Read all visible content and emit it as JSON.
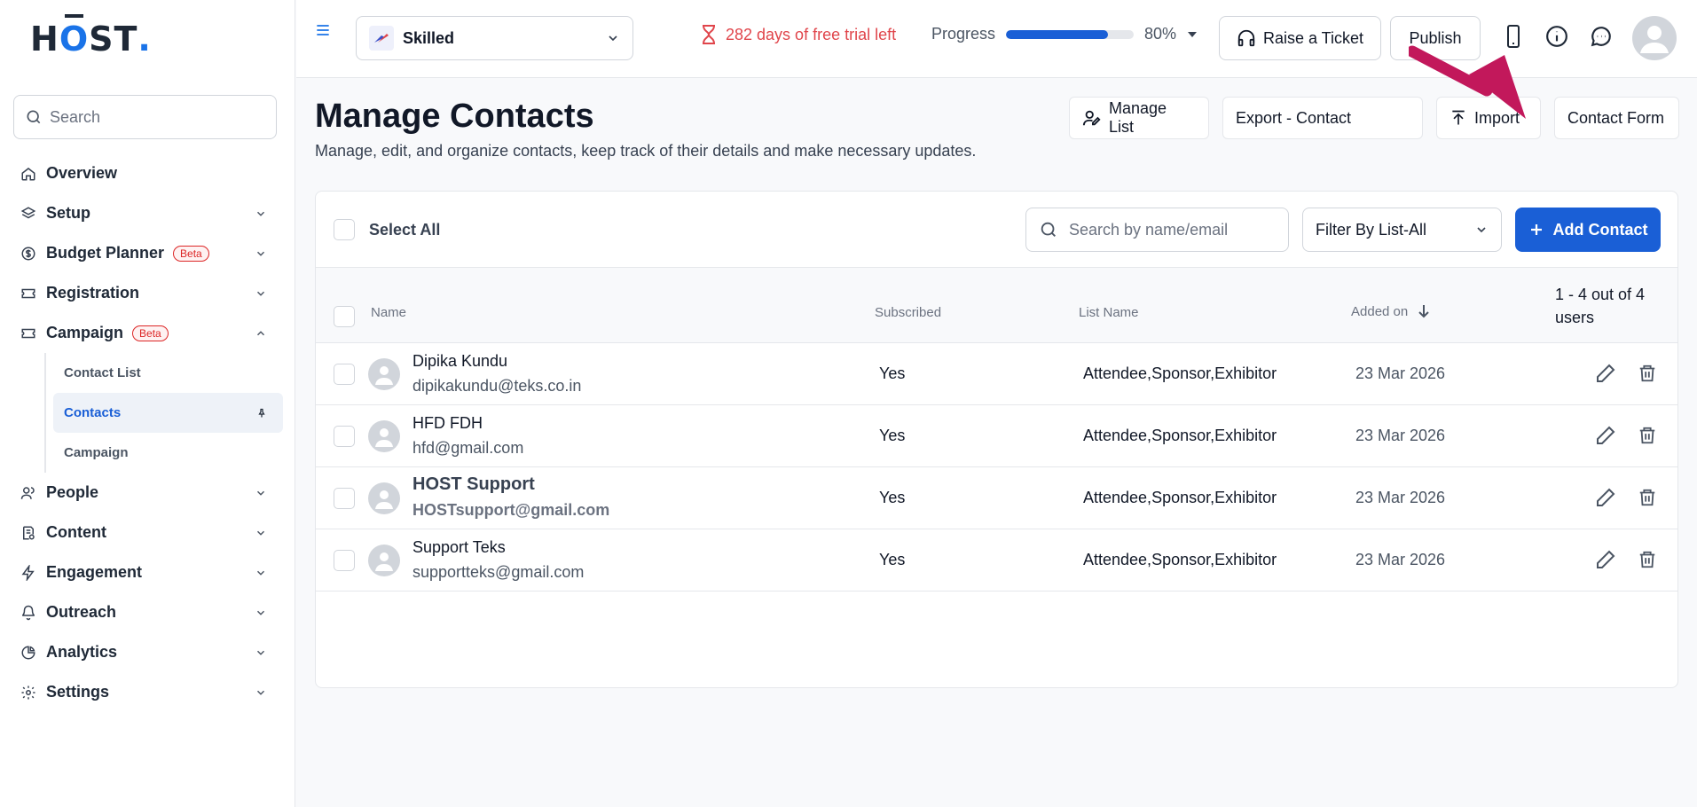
{
  "brand": {
    "logo_text": "HOST",
    "logo_dot": "."
  },
  "sidebar": {
    "search_placeholder": "Search",
    "items": [
      {
        "label": "Overview",
        "icon": "home-icon"
      },
      {
        "label": "Setup",
        "icon": "layers-icon"
      },
      {
        "label": "Budget Planner",
        "icon": "dollar-icon",
        "badge": "Beta"
      },
      {
        "label": "Registration",
        "icon": "ticket-icon"
      },
      {
        "label": "Campaign",
        "icon": "ticket-icon",
        "badge": "Beta"
      },
      {
        "label": "People",
        "icon": "users-icon"
      },
      {
        "label": "Content",
        "icon": "content-icon"
      },
      {
        "label": "Engagement",
        "icon": "zap-icon"
      },
      {
        "label": "Outreach",
        "icon": "bell-icon"
      },
      {
        "label": "Analytics",
        "icon": "pie-chart-icon"
      },
      {
        "label": "Settings",
        "icon": "gear-icon"
      }
    ],
    "campaign_sub": [
      {
        "label": "Contact List"
      },
      {
        "label": "Contacts"
      },
      {
        "label": "Campaign"
      }
    ]
  },
  "topbar": {
    "event_name": "Skilled",
    "trial_text": "282 days of free trial left",
    "progress_label": "Progress",
    "progress_value": "80%",
    "progress_fraction": 0.8,
    "raise_ticket": "Raise a Ticket",
    "publish": "Publish"
  },
  "page": {
    "title": "Manage Contacts",
    "subtitle": "Manage, edit, and organize contacts, keep track of their details and make necessary updates.",
    "manage_list": "Manage List",
    "export": "Export - Contact",
    "import": "Import",
    "contact_form": "Contact Form"
  },
  "table": {
    "select_all": "Select All",
    "search_placeholder": "Search by name/email",
    "filter": "Filter By List-All",
    "add_contact": "Add Contact",
    "columns": {
      "name": "Name",
      "subscribed": "Subscribed",
      "list_name": "List Name",
      "added_on": "Added on"
    },
    "count_text": "1 - 4 out of 4 users",
    "rows": [
      {
        "name": "Dipika Kundu",
        "email": "dipikakundu@teks.co.in",
        "subscribed": "Yes",
        "list": "Attendee,Sponsor,Exhibitor",
        "date": "23 Mar 2026"
      },
      {
        "name": "HFD FDH",
        "email": "hfd@gmail.com",
        "subscribed": "Yes",
        "list": "Attendee,Sponsor,Exhibitor",
        "date": "23 Mar 2026"
      },
      {
        "name": "HOST Support",
        "email": "HOSTsupport@gmail.com",
        "subscribed": "Yes",
        "list": "Attendee,Sponsor,Exhibitor",
        "date": "23 Mar 2026"
      },
      {
        "name": "Support Teks",
        "email": "supportteks@gmail.com",
        "subscribed": "Yes",
        "list": "Attendee,Sponsor,Exhibitor",
        "date": "23 Mar 2026"
      }
    ]
  },
  "colors": {
    "accent": "#1a5fd6",
    "warning": "#e0454b",
    "arrow": "#c2185b"
  }
}
